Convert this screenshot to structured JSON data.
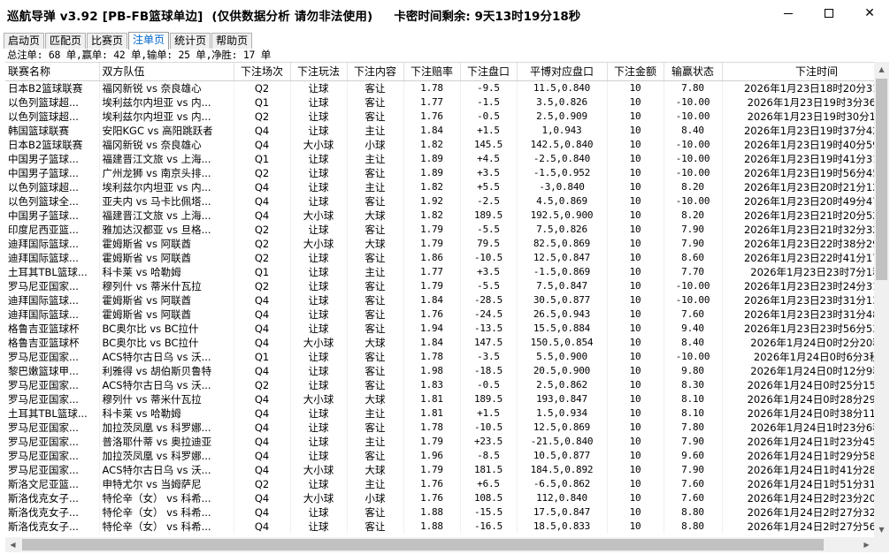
{
  "window": {
    "title": "巡航导弹 v3.92 [PB-FB篮球单边]  (仅供数据分析 请勿非法使用)",
    "countdown": "卡密时间剩余: 9天13时19分18秒",
    "minimize_label": "minimize",
    "maximize_label": "maximize",
    "close_label": "✕"
  },
  "tabs": [
    {
      "label": "启动页",
      "active": false
    },
    {
      "label": "匹配页",
      "active": false
    },
    {
      "label": "比赛页",
      "active": false
    },
    {
      "label": "注单页",
      "active": true
    },
    {
      "label": "统计页",
      "active": false
    },
    {
      "label": "帮助页",
      "active": false
    }
  ],
  "summary": "总注单: 68 单,赢单: 42 单,输单: 25 单,净胜: 17 单",
  "table": {
    "columns": [
      "联赛名称",
      "双方队伍",
      "下注场次",
      "下注玩法",
      "下注内容",
      "下注赔率",
      "下注盘口",
      "平博对应盘口",
      "下注金额",
      "输赢状态",
      "下注时间"
    ],
    "rows": [
      [
        "日本B2篮球联赛",
        "福冈新锐 vs 奈良雄心",
        "Q2",
        "让球",
        "客让",
        "1.78",
        "-9.5",
        "11.5,0.840",
        "10",
        "7.80",
        "2026年1月23日18时20分31秒"
      ],
      [
        "以色列篮球超...",
        "埃利兹尔内坦亚 vs 内...",
        "Q1",
        "让球",
        "客让",
        "1.77",
        "-1.5",
        "3.5,0.826",
        "10",
        "-10.00",
        "2026年1月23日19时3分36秒"
      ],
      [
        "以色列篮球超...",
        "埃利兹尔内坦亚 vs 内...",
        "Q2",
        "让球",
        "客让",
        "1.76",
        "-0.5",
        "2.5,0.909",
        "10",
        "-10.00",
        "2026年1月23日19时30分1秒"
      ],
      [
        "韩国篮球联赛",
        "安阳KGC vs 高阳跳跃者",
        "Q4",
        "让球",
        "主让",
        "1.84",
        "+1.5",
        "1,0.943",
        "10",
        "8.40",
        "2026年1月23日19时37分42秒"
      ],
      [
        "日本B2篮球联赛",
        "福冈新锐 vs 奈良雄心",
        "Q4",
        "大小球",
        "小球",
        "1.82",
        "145.5",
        "142.5,0.840",
        "10",
        "-10.00",
        "2026年1月23日19时40分59秒"
      ],
      [
        "中国男子篮球...",
        "福建晋江文旅 vs 上海...",
        "Q1",
        "让球",
        "主让",
        "1.89",
        "+4.5",
        "-2.5,0.840",
        "10",
        "-10.00",
        "2026年1月23日19时41分31秒"
      ],
      [
        "中国男子篮球...",
        "广州龙狮 vs 南京头排...",
        "Q2",
        "让球",
        "客让",
        "1.89",
        "+3.5",
        "-1.5,0.952",
        "10",
        "-10.00",
        "2026年1月23日19时56分45秒"
      ],
      [
        "以色列篮球超...",
        "埃利兹尔内坦亚 vs 内...",
        "Q4",
        "让球",
        "主让",
        "1.82",
        "+5.5",
        "-3,0.840",
        "10",
        "8.20",
        "2026年1月23日20时21分12秒"
      ],
      [
        "以色列篮球全...",
        "亚夫内 vs 马卡比佩塔...",
        "Q4",
        "让球",
        "客让",
        "1.92",
        "-2.5",
        "4.5,0.869",
        "10",
        "-10.00",
        "2026年1月23日20时49分47秒"
      ],
      [
        "中国男子篮球...",
        "福建晋江文旅 vs 上海...",
        "Q4",
        "大小球",
        "大球",
        "1.82",
        "189.5",
        "192.5,0.900",
        "10",
        "8.20",
        "2026年1月23日21时20分52秒"
      ],
      [
        "印度尼西亚篮...",
        "雅加达汉都亚 vs 旦格...",
        "Q2",
        "让球",
        "客让",
        "1.79",
        "-5.5",
        "7.5,0.826",
        "10",
        "7.90",
        "2026年1月23日21时32分32秒"
      ],
      [
        "迪拜国际篮球...",
        "霍姆斯省 vs 阿联酋",
        "Q2",
        "大小球",
        "大球",
        "1.79",
        "79.5",
        "82.5,0.869",
        "10",
        "7.90",
        "2026年1月23日22时38分29秒"
      ],
      [
        "迪拜国际篮球...",
        "霍姆斯省 vs 阿联酋",
        "Q2",
        "让球",
        "客让",
        "1.86",
        "-10.5",
        "12.5,0.847",
        "10",
        "8.60",
        "2026年1月23日22时41分17秒"
      ],
      [
        "土耳其TBL篮球...",
        "科卡莱 vs 哈勒姆",
        "Q1",
        "让球",
        "主让",
        "1.77",
        "+3.5",
        "-1.5,0.869",
        "10",
        "7.70",
        "2026年1月23日23时7分1秒"
      ],
      [
        "罗马尼亚国家...",
        "穆列什 vs 蒂米什瓦拉",
        "Q2",
        "让球",
        "客让",
        "1.79",
        "-5.5",
        "7.5,0.847",
        "10",
        "-10.00",
        "2026年1月23日23时24分31秒"
      ],
      [
        "迪拜国际篮球...",
        "霍姆斯省 vs 阿联酋",
        "Q4",
        "让球",
        "客让",
        "1.84",
        "-28.5",
        "30.5,0.877",
        "10",
        "-10.00",
        "2026年1月23日23时31分13秒"
      ],
      [
        "迪拜国际篮球...",
        "霍姆斯省 vs 阿联酋",
        "Q4",
        "让球",
        "客让",
        "1.76",
        "-24.5",
        "26.5,0.943",
        "10",
        "7.60",
        "2026年1月23日23时31分48秒"
      ],
      [
        "格鲁吉亚篮球杯",
        "BC奥尔比 vs BC拉什",
        "Q4",
        "让球",
        "客让",
        "1.94",
        "-13.5",
        "15.5,0.884",
        "10",
        "9.40",
        "2026年1月23日23时56分53秒"
      ],
      [
        "格鲁吉亚篮球杯",
        "BC奥尔比 vs BC拉什",
        "Q4",
        "大小球",
        "大球",
        "1.84",
        "147.5",
        "150.5,0.854",
        "10",
        "8.40",
        "2026年1月24日0时2分20秒"
      ],
      [
        "罗马尼亚国家...",
        "ACS特尔古日乌 vs 沃...",
        "Q1",
        "让球",
        "客让",
        "1.78",
        "-3.5",
        "5.5,0.900",
        "10",
        "-10.00",
        "2026年1月24日0时6分3秒"
      ],
      [
        "黎巴嫩篮球甲...",
        "利雅得 vs 胡伯斯贝鲁特",
        "Q4",
        "让球",
        "客让",
        "1.98",
        "-18.5",
        "20.5,0.900",
        "10",
        "9.80",
        "2026年1月24日0时12分9秒"
      ],
      [
        "罗马尼亚国家...",
        "ACS特尔古日乌 vs 沃...",
        "Q2",
        "让球",
        "客让",
        "1.83",
        "-0.5",
        "2.5,0.862",
        "10",
        "8.30",
        "2026年1月24日0时25分15秒"
      ],
      [
        "罗马尼亚国家...",
        "穆列什 vs 蒂米什瓦拉",
        "Q4",
        "大小球",
        "大球",
        "1.81",
        "189.5",
        "193,0.847",
        "10",
        "8.10",
        "2026年1月24日0时28分29秒"
      ],
      [
        "土耳其TBL篮球...",
        "科卡莱 vs 哈勒姆",
        "Q4",
        "让球",
        "主让",
        "1.81",
        "+1.5",
        "1.5,0.934",
        "10",
        "8.10",
        "2026年1月24日0时38分11秒"
      ],
      [
        "罗马尼亚国家...",
        "加拉茨凤凰 vs 科罗娜...",
        "Q4",
        "让球",
        "客让",
        "1.78",
        "-10.5",
        "12.5,0.869",
        "10",
        "7.80",
        "2026年1月24日1时23分6秒"
      ],
      [
        "罗马尼亚国家...",
        "普洛耶什蒂 vs 奥拉迪亚",
        "Q4",
        "让球",
        "主让",
        "1.79",
        "+23.5",
        "-21.5,0.840",
        "10",
        "7.90",
        "2026年1月24日1时23分45秒"
      ],
      [
        "罗马尼亚国家...",
        "加拉茨凤凰 vs 科罗娜...",
        "Q4",
        "让球",
        "客让",
        "1.96",
        "-8.5",
        "10.5,0.877",
        "10",
        "9.60",
        "2026年1月24日1时29分58秒"
      ],
      [
        "罗马尼亚国家...",
        "ACS特尔古日乌 vs 沃...",
        "Q4",
        "大小球",
        "大球",
        "1.79",
        "181.5",
        "184.5,0.892",
        "10",
        "7.90",
        "2026年1月24日1时41分28秒"
      ],
      [
        "斯洛文尼亚篮...",
        "申特尤尔 vs 当姆萨尼",
        "Q2",
        "让球",
        "主让",
        "1.76",
        "+6.5",
        "-6.5,0.862",
        "10",
        "7.60",
        "2026年1月24日1时51分31秒"
      ],
      [
        "斯洛伐克女子...",
        "特伦辛（女） vs 科希...",
        "Q4",
        "大小球",
        "小球",
        "1.76",
        "108.5",
        "112,0.840",
        "10",
        "7.60",
        "2026年1月24日2时23分20秒"
      ],
      [
        "斯洛伐克女子...",
        "特伦辛（女） vs 科希...",
        "Q4",
        "让球",
        "客让",
        "1.88",
        "-15.5",
        "17.5,0.847",
        "10",
        "8.80",
        "2026年1月24日2时27分32秒"
      ],
      [
        "斯洛伐克女子...",
        "特伦辛（女） vs 科希...",
        "Q4",
        "让球",
        "客让",
        "1.88",
        "-16.5",
        "18.5,0.833",
        "10",
        "8.80",
        "2026年1月24日2时27分56秒"
      ]
    ]
  }
}
